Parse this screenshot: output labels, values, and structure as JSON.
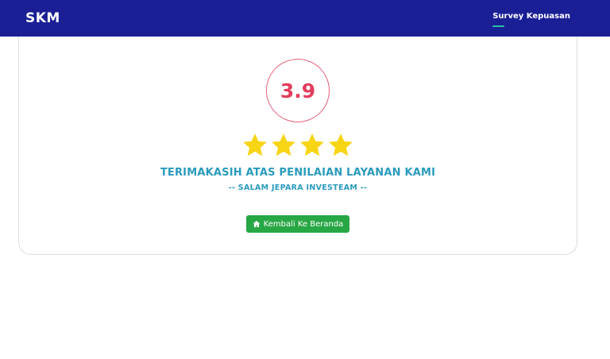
{
  "navbar": {
    "brand": "SKM",
    "link_label": "Survey Kepuasan"
  },
  "result": {
    "score": "3.9",
    "rating_stars": 4,
    "star_color": "#f7d414",
    "title": "TERIMAKASIH ATAS PENILAIAN LAYANAN KAMI",
    "subtitle": "-- SALAM JEPARA INVESTEAM --",
    "button_label": "Kembali Ke Beranda",
    "button_icon": "home-icon"
  },
  "colors": {
    "navbar_bg": "#1a1f96",
    "score": "#e33d5c",
    "accent_text": "#2a9bbd",
    "button": "#28a745",
    "nav_underline": "#27c0a0"
  }
}
